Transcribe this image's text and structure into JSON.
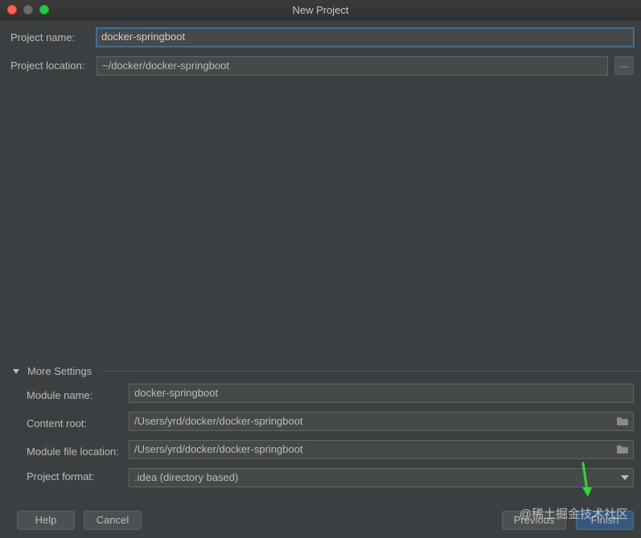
{
  "window": {
    "title": "New Project"
  },
  "project": {
    "name_label": "Project name:",
    "name_value": "docker-springboot",
    "location_label": "Project location:",
    "location_value": "~/docker/docker-springboot",
    "browse_label": "..."
  },
  "more_settings": {
    "title": "More Settings",
    "module_name_label": "Module name:",
    "module_name_value": "docker-springboot",
    "content_root_label": "Content root:",
    "content_root_value": "/Users/yrd/docker/docker-springboot",
    "module_file_label": "Module file location:",
    "module_file_value": "/Users/yrd/docker/docker-springboot",
    "format_label": "Project format:",
    "format_value": ".idea (directory based)"
  },
  "buttons": {
    "help": "Help",
    "cancel": "Cancel",
    "previous": "Previous",
    "finish": "Finish"
  },
  "watermark": "@稀土掘金技术社区",
  "icons": {
    "folder": "folder-icon",
    "dropdown": "chevron-down-icon",
    "collapse": "triangle-down-icon",
    "annotation": "arrow-annotation-icon"
  },
  "colors": {
    "background": "#3c3f41",
    "field": "#45494a",
    "focus_border": "#466d94",
    "default_button": "#365880",
    "annotation_arrow": "#2fd82f"
  }
}
